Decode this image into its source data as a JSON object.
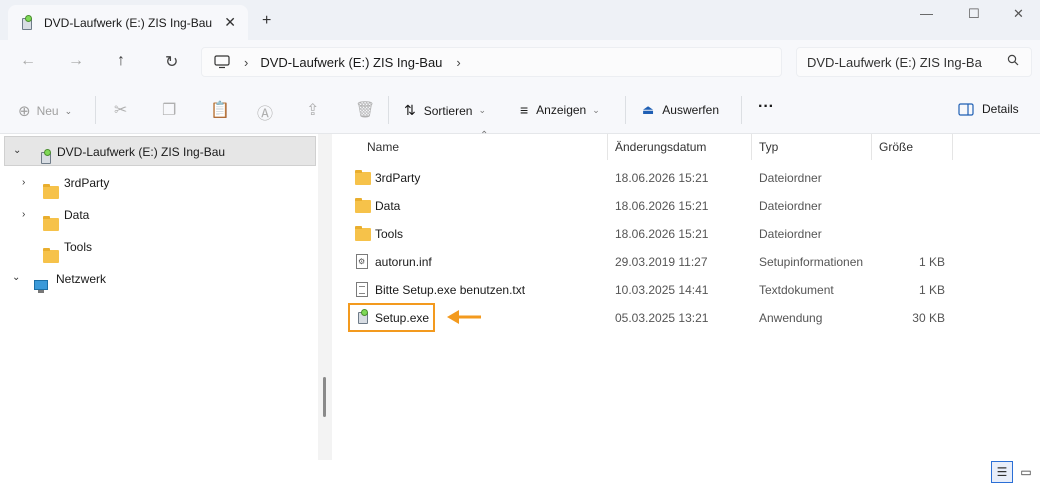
{
  "tab": {
    "title": "DVD-Laufwerk (E:) ZIS Ing-Bau",
    "icon": "dvd-drive-icon",
    "close": "✕",
    "new": "+"
  },
  "window": {
    "minimize": "—",
    "maximize": "☐",
    "close": "✕"
  },
  "nav": {
    "back": "←",
    "forward": "→",
    "up": "↑",
    "refresh": "↻",
    "address": {
      "root_icon": "monitor-icon",
      "sep1": "›",
      "path": "DVD-Laufwerk (E:) ZIS Ing-Bau",
      "sep2": "›"
    },
    "search": {
      "placeholder": "DVD-Laufwerk (E:) ZIS Ing-Ba",
      "icon": "search-icon"
    }
  },
  "toolbar": {
    "new_label": "Neu",
    "sort_label": "Sortieren",
    "view_label": "Anzeigen",
    "eject_label": "Auswerfen",
    "more_label": "···",
    "details_label": "Details"
  },
  "tree": {
    "root": "DVD-Laufwerk (E:) ZIS Ing-Bau",
    "children": [
      "3rdParty",
      "Data",
      "Tools"
    ],
    "network": "Netzwerk"
  },
  "columns": {
    "name": "Name",
    "modified": "Änderungsdatum",
    "type": "Typ",
    "size": "Größe"
  },
  "files": [
    {
      "name": "3rdParty",
      "modified": "18.06.2026 15:21",
      "type": "Dateiordner",
      "size": "",
      "icon": "folder-icon"
    },
    {
      "name": "Data",
      "modified": "18.06.2026 15:21",
      "type": "Dateiordner",
      "size": "",
      "icon": "folder-icon"
    },
    {
      "name": "Tools",
      "modified": "18.06.2026 15:21",
      "type": "Dateiordner",
      "size": "",
      "icon": "folder-icon"
    },
    {
      "name": "autorun.inf",
      "modified": "29.03.2019 11:27",
      "type": "Setupinformationen",
      "size": "1 KB",
      "icon": "inf-file-icon"
    },
    {
      "name": "Bitte Setup.exe benutzen.txt",
      "modified": "10.03.2025 14:41",
      "type": "Textdokument",
      "size": "1 KB",
      "icon": "text-file-icon"
    },
    {
      "name": "Setup.exe",
      "modified": "05.03.2025 13:21",
      "type": "Anwendung",
      "size": "30 KB",
      "icon": "setup-exe-icon"
    }
  ],
  "colors": {
    "highlight": "#f39a1e",
    "accent": "#2b6fd6"
  }
}
